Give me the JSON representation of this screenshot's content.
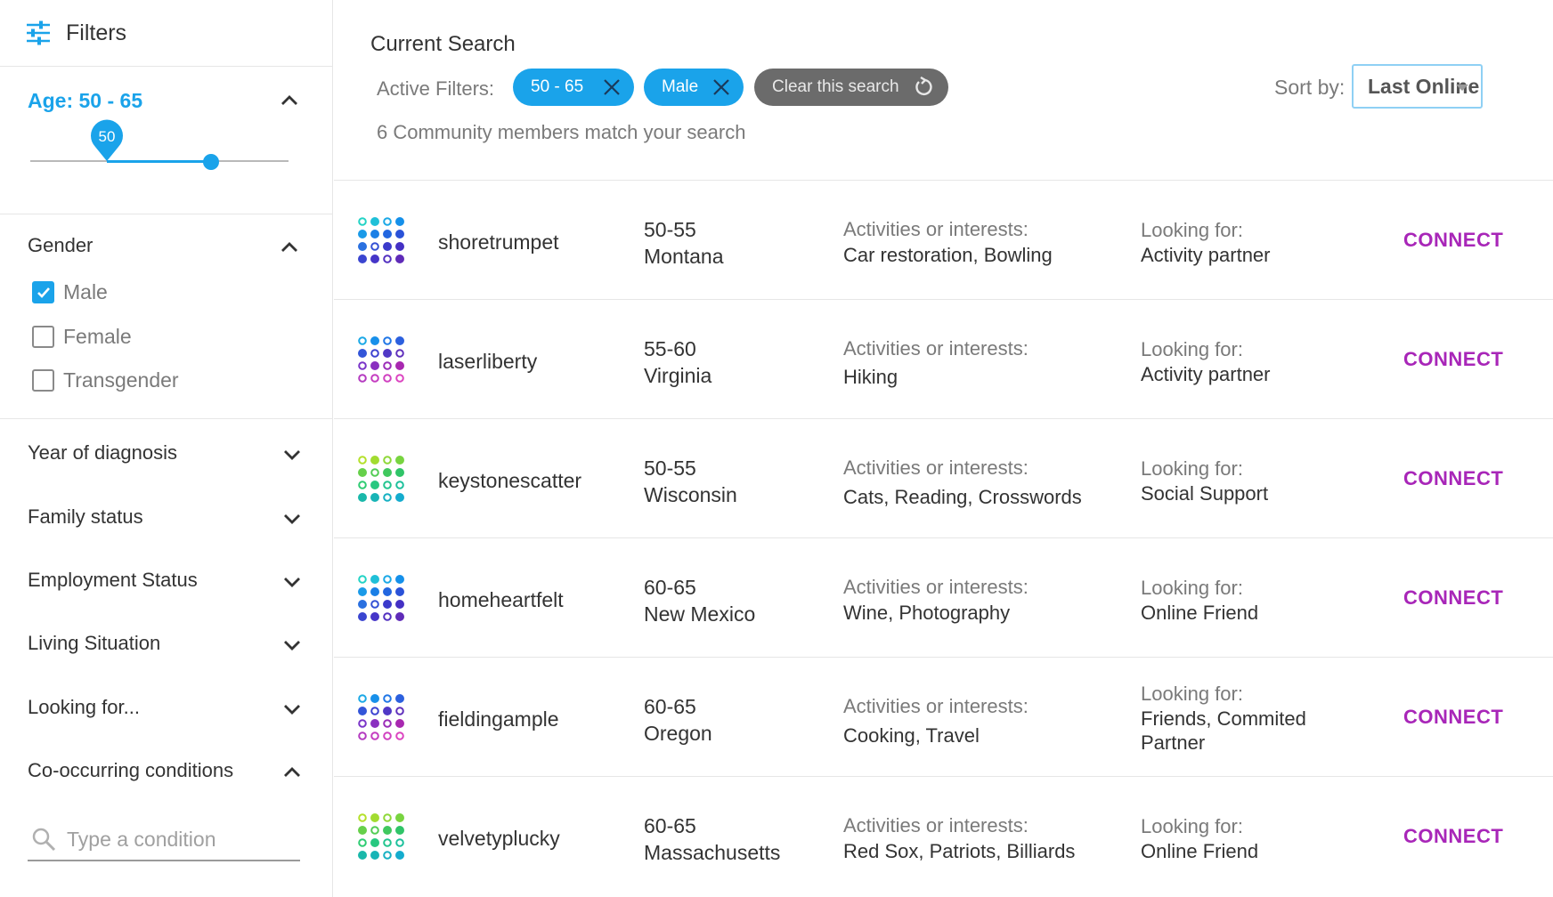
{
  "sidebar": {
    "title": "Filters",
    "age": {
      "title": "Age: 50 - 65",
      "slider_min_value": "50",
      "slider_range": [
        50,
        65
      ]
    },
    "gender": {
      "title": "Gender",
      "options": [
        {
          "label": "Male",
          "checked": true
        },
        {
          "label": "Female",
          "checked": false
        },
        {
          "label": "Transgender",
          "checked": false
        }
      ]
    },
    "sections": [
      {
        "label": "Year of diagnosis",
        "expanded": false
      },
      {
        "label": "Family status",
        "expanded": false
      },
      {
        "label": "Employment Status",
        "expanded": false
      },
      {
        "label": "Living Situation",
        "expanded": false
      },
      {
        "label": "Looking for...",
        "expanded": false
      },
      {
        "label": "Co-occurring conditions",
        "expanded": true
      }
    ],
    "condition_search": {
      "placeholder": "Type a condition"
    }
  },
  "search": {
    "title": "Current Search",
    "active_filters_label": "Active Filters:",
    "chips": [
      "50 - 65",
      "Male"
    ],
    "clear_label": "Clear this search",
    "match_text": "6 Community members match your search",
    "sort_label": "Sort by:",
    "sort_value": "Last Online"
  },
  "results": [
    {
      "username": "shoretrumpet",
      "age": "50-55",
      "location": "Montana",
      "activities_label": "Activities or interests:",
      "activities": "Car restoration, Bowling",
      "looking_label": "Looking for:",
      "looking": "Activity partner",
      "connect": "CONNECT",
      "avatar_palette": "blue"
    },
    {
      "username": "laserliberty",
      "age": "55-60",
      "location": "Virginia",
      "activities_label": "Activities or interests:",
      "activities": "Hiking",
      "looking_label": "Looking for:",
      "looking": "Activity partner",
      "connect": "CONNECT",
      "avatar_palette": "purple"
    },
    {
      "username": "keystonescatter",
      "age": "50-55",
      "location": "Wisconsin",
      "activities_label": "Activities or interests:",
      "activities": "Cats, Reading, Crosswords",
      "looking_label": "Looking for:",
      "looking": "Social Support",
      "connect": "CONNECT",
      "avatar_palette": "green"
    },
    {
      "username": "homeheartfelt",
      "age": "60-65",
      "location": "New Mexico",
      "activities_label": "Activities or interests:",
      "activities": "Wine, Photography",
      "looking_label": "Looking for:",
      "looking": "Online Friend",
      "connect": "CONNECT",
      "avatar_palette": "blue"
    },
    {
      "username": "fieldingample",
      "age": "60-65",
      "location": "Oregon",
      "activities_label": "Activities or interests:",
      "activities": "Cooking, Travel",
      "looking_label": "Looking for:",
      "looking": "Friends, Commited Partner",
      "connect": "CONNECT",
      "avatar_palette": "purple"
    },
    {
      "username": "velvetyplucky",
      "age": "60-65",
      "location": "Massachusetts",
      "activities_label": "Activities or interests:",
      "activities": "Red Sox, Patriots, Billiards",
      "looking_label": "Looking for:",
      "looking": "Online Friend",
      "connect": "CONNECT",
      "avatar_palette": "green"
    }
  ],
  "colors": {
    "accent": "#1aa3ea",
    "connect": "#a826b8",
    "clear_chip": "#6b6b6b"
  }
}
